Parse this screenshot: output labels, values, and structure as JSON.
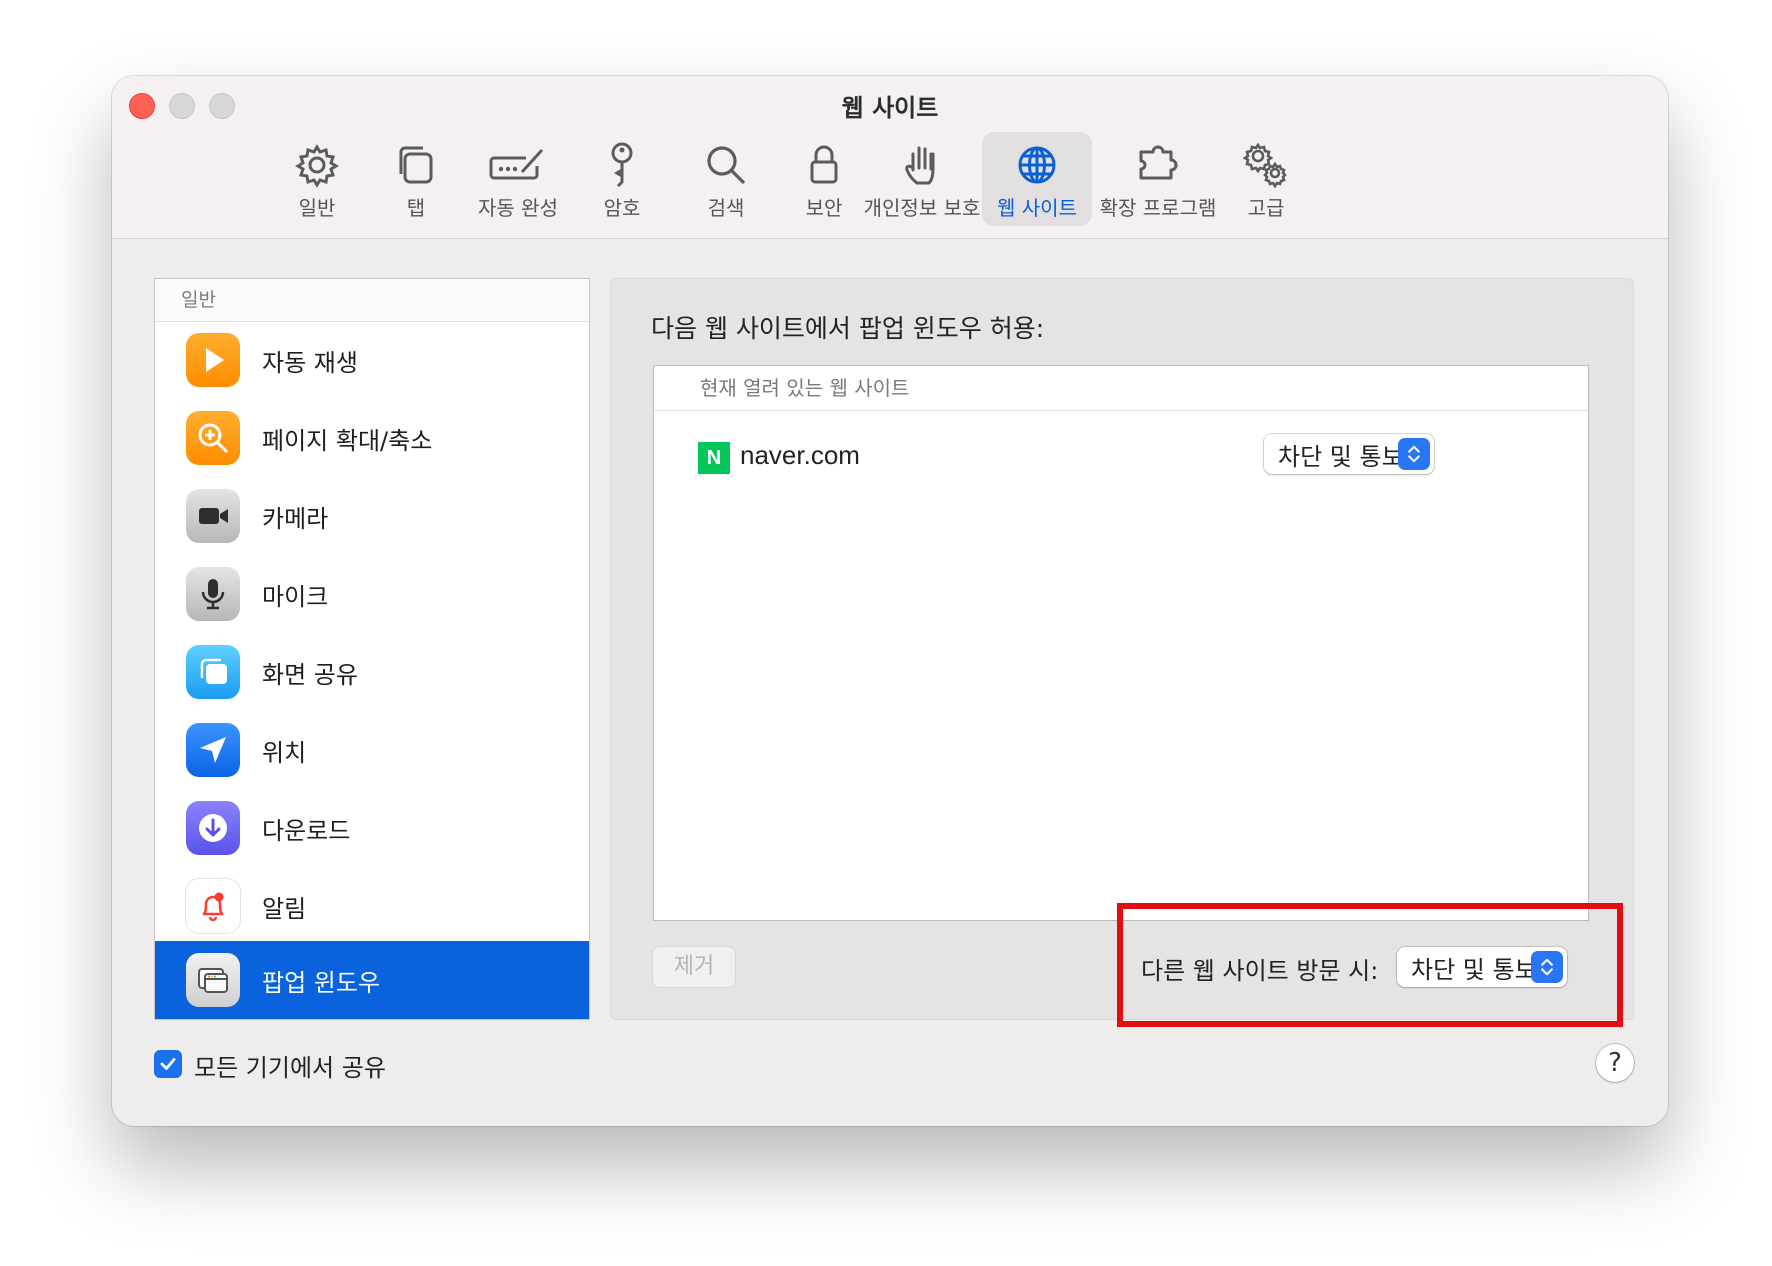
{
  "window": {
    "title": "웹 사이트"
  },
  "toolbar": {
    "items": [
      {
        "label": "일반",
        "icon": "gear-icon"
      },
      {
        "label": "탭",
        "icon": "tabs-icon"
      },
      {
        "label": "자동 완성",
        "icon": "autofill-icon"
      },
      {
        "label": "암호",
        "icon": "key-icon"
      },
      {
        "label": "검색",
        "icon": "search-icon"
      },
      {
        "label": "보안",
        "icon": "lock-icon"
      },
      {
        "label": "개인정보 보호",
        "icon": "hand-icon"
      },
      {
        "label": "웹 사이트",
        "icon": "globe-icon",
        "selected": true
      },
      {
        "label": "확장 프로그램",
        "icon": "puzzle-icon"
      },
      {
        "label": "고급",
        "icon": "gears-icon"
      }
    ]
  },
  "sidebar": {
    "header": "일반",
    "items": [
      {
        "label": "자동 재생",
        "icon": "play-icon"
      },
      {
        "label": "페이지 확대/축소",
        "icon": "zoom-icon"
      },
      {
        "label": "카메라",
        "icon": "camera-icon"
      },
      {
        "label": "마이크",
        "icon": "microphone-icon"
      },
      {
        "label": "화면 공유",
        "icon": "screen-share-icon"
      },
      {
        "label": "위치",
        "icon": "location-icon"
      },
      {
        "label": "다운로드",
        "icon": "download-icon"
      },
      {
        "label": "알림",
        "icon": "bell-icon"
      },
      {
        "label": "팝업 윈도우",
        "icon": "popup-window-icon",
        "selected": true
      }
    ]
  },
  "main": {
    "title": "다음 웹 사이트에서 팝업 윈도우 허용:",
    "list_header": "현재 열려 있는 웹 사이트",
    "sites": [
      {
        "favicon": "N",
        "name": "naver.com",
        "setting": "차단 및 통보"
      }
    ],
    "remove_label": "제거",
    "other_label": "다른 웹 사이트 방문 시:",
    "other_setting": "차단 및 통보"
  },
  "footer": {
    "share_label": "모든 기기에서 공유",
    "share_checked": true,
    "help_label": "?"
  },
  "colors": {
    "accent": "#0a62dc",
    "highlight": "#e10d13",
    "naver": "#03c75a"
  }
}
